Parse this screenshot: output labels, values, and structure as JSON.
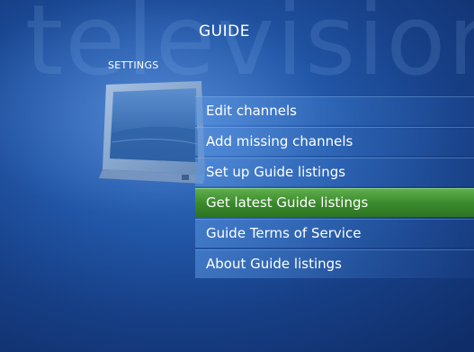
{
  "watermark": "television",
  "header": {
    "title": "GUIDE",
    "section": "SETTINGS"
  },
  "menu": {
    "items": [
      {
        "label": "Edit channels",
        "selected": false
      },
      {
        "label": "Add missing channels",
        "selected": false
      },
      {
        "label": "Set up Guide listings",
        "selected": false
      },
      {
        "label": "Get latest Guide listings",
        "selected": true
      },
      {
        "label": "Guide Terms of Service",
        "selected": false
      },
      {
        "label": "About Guide listings",
        "selected": false
      }
    ]
  },
  "icons": {
    "tv": "television-icon"
  },
  "colors": {
    "background": "#2257a8",
    "selected": "#3b8a2d",
    "text": "#ffffff"
  }
}
